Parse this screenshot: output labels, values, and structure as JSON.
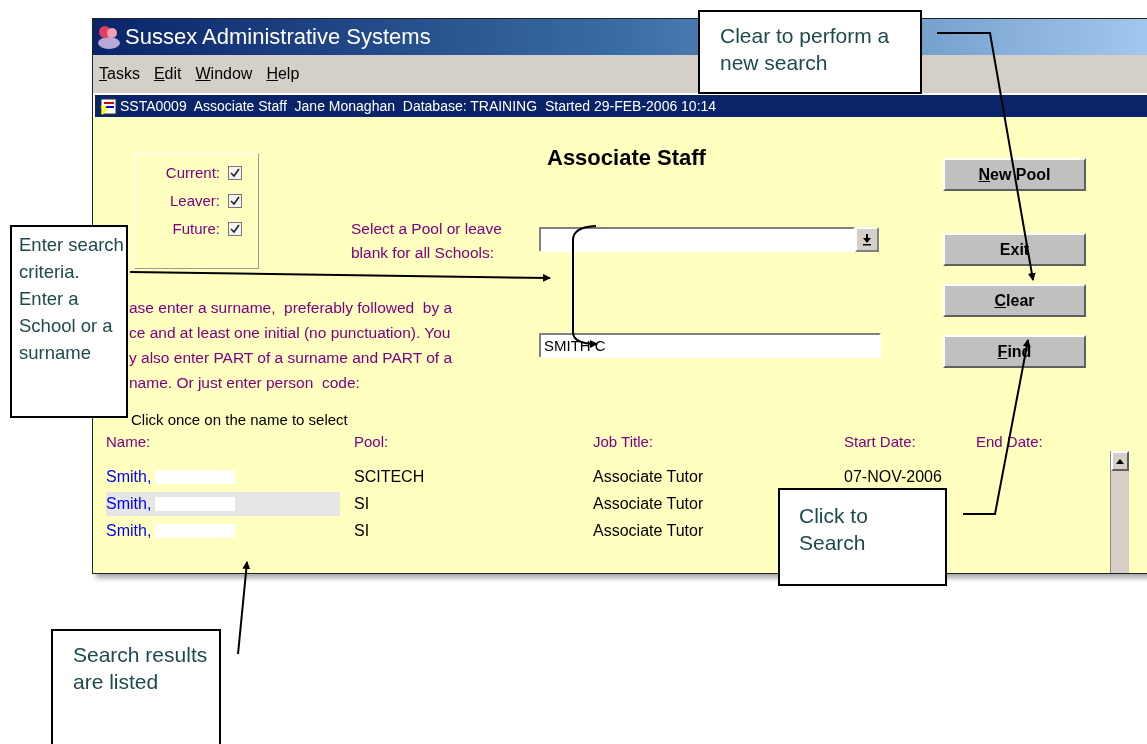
{
  "window": {
    "title": "Sussex Administrative Systems"
  },
  "menu": [
    {
      "label": "Tasks"
    },
    {
      "label": "Edit"
    },
    {
      "label": "Window"
    },
    {
      "label": "Help"
    }
  ],
  "status_bar": {
    "text": "SSTA0009  Associate Staff  Jane Monaghan  Database: TRAINING  Started 29-FEB-2006 10:14"
  },
  "form": {
    "title": "Associate Staff",
    "filters": [
      {
        "label": "Current:",
        "checked": true
      },
      {
        "label": "Leaver:",
        "checked": true
      },
      {
        "label": "Future:",
        "checked": true
      }
    ],
    "pool_label": "Select a Pool or leave blank for all Schools:",
    "instructions": [
      "ase enter a surname,  preferably followed  by a",
      "ce and at least one initial (no punctuation). You",
      "y also enter PART of a surname and PART of a",
      "name. Or just enter person  code:"
    ],
    "surname_field": {
      "value": "SMITH C"
    }
  },
  "buttons": [
    {
      "label": "New Pool",
      "mnemonic": true
    },
    {
      "label": "Exit",
      "mnemonic": false
    },
    {
      "label": "Clear",
      "mnemonic": true
    },
    {
      "label": "Find",
      "mnemonic": true
    }
  ],
  "results": {
    "hint": "Click once on the name to select",
    "columns": [
      "Name:",
      "Pool:",
      "Job Title:",
      "Start Date:",
      "End Date:"
    ],
    "rows": [
      {
        "name": "Smith,",
        "pool": "SCITECH",
        "job_title": "Associate Tutor",
        "start_date": "07-NOV-2006",
        "selected": false
      },
      {
        "name": "Smith,",
        "pool": "SI",
        "job_title": "Associate Tutor",
        "selected": true
      },
      {
        "name": "Smith,",
        "pool": "SI",
        "job_title": "Associate Tutor",
        "selected": false
      }
    ]
  },
  "callouts": [
    {
      "kind": "clear",
      "text": "Clear to perform a new search"
    },
    {
      "kind": "criteria",
      "text": "Enter search criteria. Enter a School or a surname"
    },
    {
      "kind": "find",
      "text": "Click to Search"
    },
    {
      "kind": "results",
      "text": "Search results are listed"
    }
  ]
}
